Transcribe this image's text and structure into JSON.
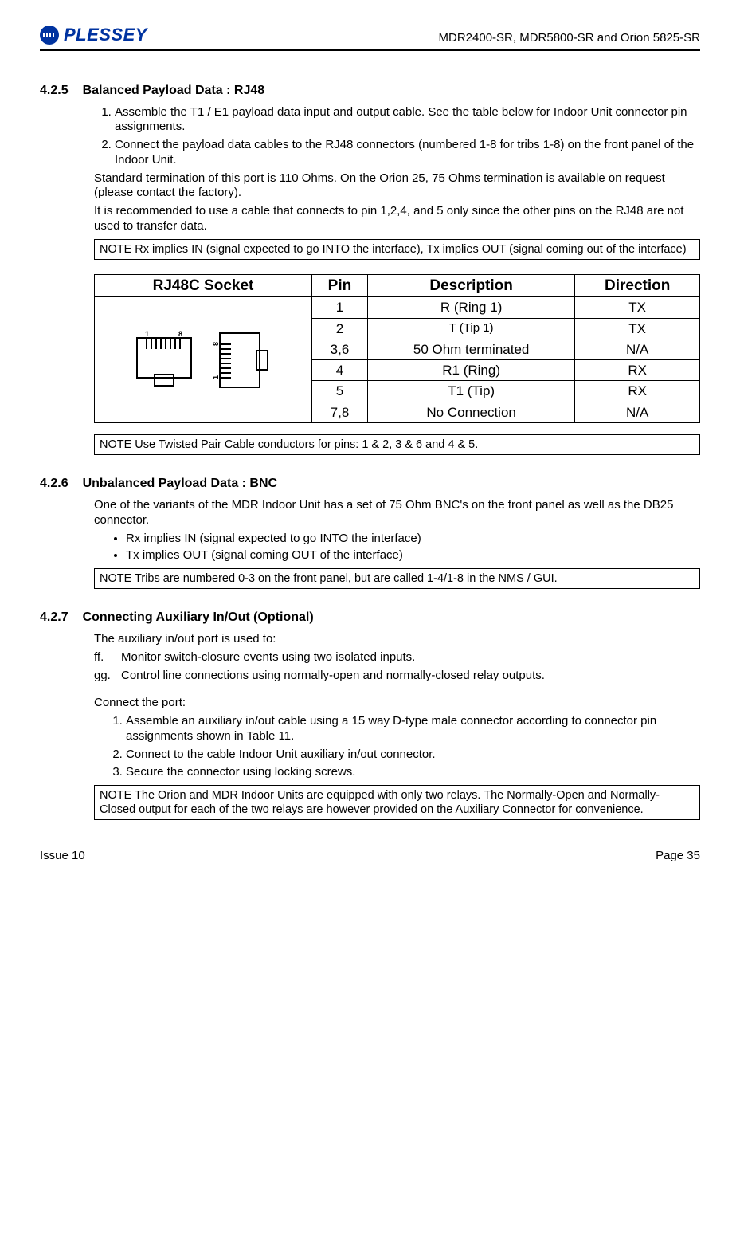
{
  "header": {
    "logo_text": "PLESSEY",
    "doc_title": "MDR2400-SR, MDR5800-SR and Orion 5825-SR"
  },
  "s1": {
    "num": "4.2.5",
    "title": "Balanced Payload Data : RJ48",
    "steps": [
      "Assemble the T1 / E1 payload data input and output cable.  See the table below for Indoor Unit connector pin assignments.",
      "Connect the payload data cables to the RJ48 connectors (numbered 1-8 for tribs 1-8) on the front panel of the Indoor Unit."
    ],
    "para1": "Standard termination of this port is 110 Ohms.  On the Orion 25, 75 Ohms termination is available on request (please contact the factory).",
    "para2": "It is recommended to use a cable that connects to pin 1,2,4, and 5 only since the other pins on the RJ48 are not used to transfer data.",
    "note1": "NOTE Rx implies IN (signal expected to go INTO the interface), Tx implies OUT (signal coming out of the interface)",
    "table": {
      "headers": [
        "RJ48C Socket",
        "Pin",
        "Description",
        "Direction"
      ],
      "rows": [
        {
          "pin": "1",
          "desc": "R (Ring 1)",
          "dir": "TX"
        },
        {
          "pin": "2",
          "desc": "T (Tip 1)",
          "dir": "TX"
        },
        {
          "pin": "3,6",
          "desc": "50 Ohm terminated",
          "dir": "N/A"
        },
        {
          "pin": "4",
          "desc": "R1 (Ring)",
          "dir": "RX"
        },
        {
          "pin": "5",
          "desc": "T1 (Tip)",
          "dir": "RX"
        },
        {
          "pin": "7,8",
          "desc": "No Connection",
          "dir": "N/A"
        }
      ]
    },
    "note2": "NOTE  Use Twisted Pair Cable conductors for pins: 1 & 2, 3 & 6 and 4 & 5."
  },
  "s2": {
    "num": "4.2.6",
    "title": "Unbalanced Payload Data : BNC",
    "intro": "One of the variants of the MDR Indoor Unit has a set of 75 Ohm BNC's on the front panel as well as the DB25 connector.",
    "bullets": [
      "Rx implies IN (signal expected to go INTO the interface)",
      "Tx implies OUT (signal coming OUT of the interface)"
    ],
    "note": "NOTE Tribs are numbered 0-3 on the front panel, but are called 1-4/1-8 in the NMS / GUI."
  },
  "s3": {
    "num": "4.2.7",
    "title": "Connecting Auxiliary In/Out (Optional)",
    "intro": "The auxiliary in/out port is used to:",
    "items": [
      {
        "label": "ff.",
        "text": "Monitor switch-closure events using two isolated inputs."
      },
      {
        "label": "gg.",
        "text": "Control line connections using normally-open and normally-closed relay outputs."
      }
    ],
    "connect_intro": "Connect the port:",
    "steps": [
      "Assemble an auxiliary in/out cable using a 15 way D-type male connector according to connector pin assignments shown in Table 11.",
      "Connect to the cable Indoor Unit auxiliary in/out connector.",
      "Secure the connector using locking screws."
    ],
    "note": "NOTE  The Orion and MDR Indoor Units are equipped with only two relays.  The Normally-Open and Normally-Closed output for each of the two relays are however provided on the Auxiliary Connector for convenience."
  },
  "footer": {
    "left": "Issue 10",
    "right": "Page 35"
  }
}
